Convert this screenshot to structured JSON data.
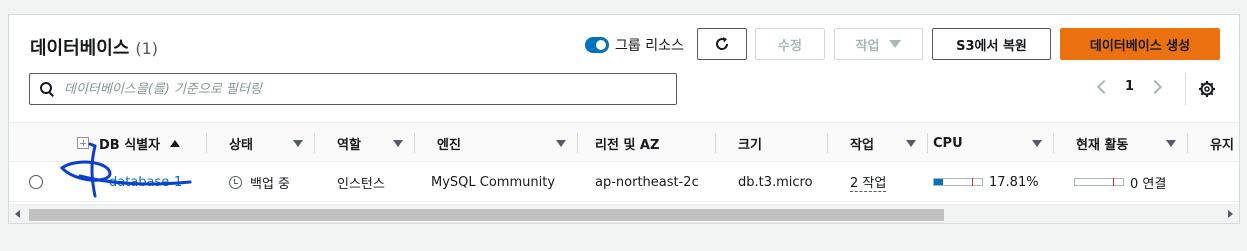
{
  "header": {
    "title": "데이터베이스",
    "count": "(1)",
    "group_toggle_label": "그룹 리소스",
    "buttons": {
      "edit": "수정",
      "actions": "작업",
      "restore": "S3에서 복원",
      "create": "데이터베이스 생성"
    }
  },
  "search": {
    "placeholder": "데이터베이스을(를) 기준으로 필터링"
  },
  "pager": {
    "page": "1"
  },
  "table": {
    "columns": [
      "DB 식별자",
      "상태",
      "역할",
      "엔진",
      "리전 및 AZ",
      "크기",
      "작업",
      "CPU",
      "현재 활동",
      "유지"
    ],
    "rows": [
      {
        "id": "database-1",
        "status": "백업 중",
        "role": "인스턴스",
        "engine": "MySQL Community",
        "region": "ap-northeast-2c",
        "size": "db.t3.micro",
        "actions": "2 작업",
        "cpu": "17.81%",
        "cpu_value": 17.81,
        "activity": "0 연결"
      }
    ]
  },
  "colors": {
    "primary": "#ec7211",
    "link": "#0073bb",
    "annotation": "#0b3fcf"
  },
  "icons": {
    "refresh": "refresh-icon",
    "search": "search-icon",
    "settings": "gear-icon",
    "status": "clock-icon"
  }
}
